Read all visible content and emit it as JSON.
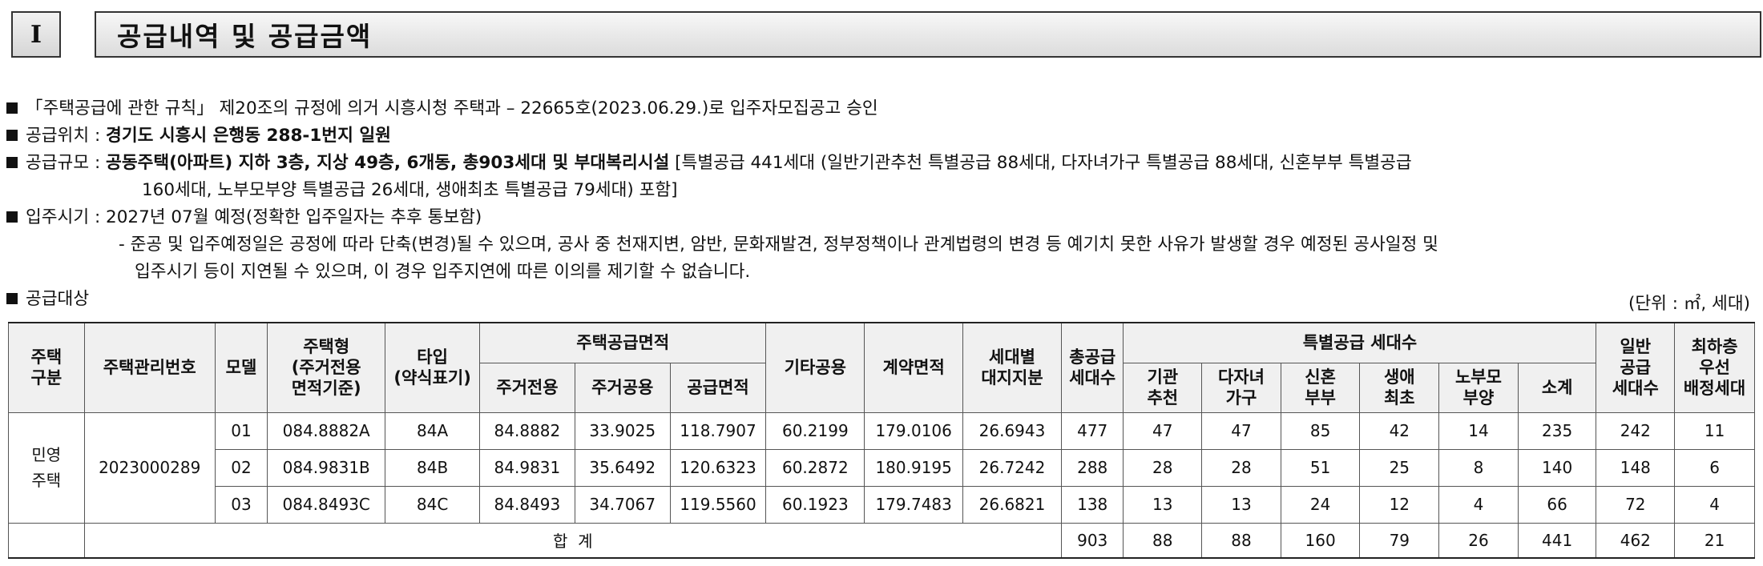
{
  "section": {
    "number": "I",
    "title": "공급내역 및 공급금액"
  },
  "bullets": {
    "l1": "「주택공급에 관한 규칙」 제20조의 규정에 의거 시흥시청 주택과 – 22665호(2023.06.29.)로 입주자모집공고 승인",
    "l2_label": "공급위치 : ",
    "l2_value": "경기도 시흥시 은행동 288-1번지 일원",
    "l3_label": "공급규모 : ",
    "l3_bold": "공동주택(아파트) 지하 3층, 지상 49층, 6개동, 총903세대 및 부대복리시설",
    "l3_rest": " [특별공급 441세대 (일반기관추천 특별공급 88세대, 다자녀가구 특별공급 88세대, 신혼부부 특별공급",
    "l3_cont": "160세대, 노부모부양 특별공급 26세대, 생애최초 특별공급 79세대) 포함]",
    "l4": "입주시기 : 2027년 07월 예정(정확한 입주일자는 추후 통보함)",
    "l4_note1": "- 준공 및 입주예정일은 공정에 따라 단축(변경)될 수 있으며, 공사 중 천재지변, 암반, 문화재발견, 정부정책이나 관계법령의 변경 등 예기치 못한 사유가 발생할 경우 예정된 공사일정 및",
    "l4_note2": "입주시기 등이 지연될 수 있으며, 이 경우 입주지연에 따른 이의를 제기할 수 없습니다.",
    "l5": "공급대상"
  },
  "unit": "(단위 : ㎡, 세대)",
  "table": {
    "h_type": "주택\n구분",
    "h_mgmt": "주택관리번호",
    "h_model": "모델",
    "h_htype": "주택형\n(주거전용\n면적기준)",
    "h_tab": "타입\n(약식표기)",
    "h_area": "주택공급면적",
    "h_area_excl": "주거전용",
    "h_area_common": "주거공용",
    "h_area_supply": "공급면적",
    "h_other": "기타공용",
    "h_contract": "계약면적",
    "h_land": "세대별\n대지지분",
    "h_total": "총공급\n세대수",
    "h_special": "특별공급 세대수",
    "h_sp_inst": "기관\n추천",
    "h_sp_multi": "다자녀\n가구",
    "h_sp_newly": "신혼\n부부",
    "h_sp_first": "생애\n최초",
    "h_sp_elder": "노부모\n부양",
    "h_sp_sum": "소계",
    "h_general": "일반\n공급\n세대수",
    "h_lowest": "최하층\n우선\n배정세대",
    "house_type": "민영\n주택",
    "mgmt_no": "2023000289",
    "rows": [
      {
        "model": "01",
        "htype": "084.8882A",
        "tab": "84A",
        "excl": "84.8882",
        "common": "33.9025",
        "supply": "118.7907",
        "other": "60.2199",
        "contract": "179.0106",
        "land": "26.6943",
        "total": "477",
        "inst": "47",
        "multi": "47",
        "newly": "85",
        "first": "42",
        "elder": "14",
        "sum": "235",
        "general": "242",
        "lowest": "11"
      },
      {
        "model": "02",
        "htype": "084.9831B",
        "tab": "84B",
        "excl": "84.9831",
        "common": "35.6492",
        "supply": "120.6323",
        "other": "60.2872",
        "contract": "180.9195",
        "land": "26.7242",
        "total": "288",
        "inst": "28",
        "multi": "28",
        "newly": "51",
        "first": "25",
        "elder": "8",
        "sum": "140",
        "general": "148",
        "lowest": "6"
      },
      {
        "model": "03",
        "htype": "084.8493C",
        "tab": "84C",
        "excl": "84.8493",
        "common": "34.7067",
        "supply": "119.5560",
        "other": "60.1923",
        "contract": "179.7483",
        "land": "26.6821",
        "total": "138",
        "inst": "13",
        "multi": "13",
        "newly": "24",
        "first": "12",
        "elder": "4",
        "sum": "66",
        "general": "72",
        "lowest": "4"
      }
    ],
    "sum_label": "합  계",
    "sum": {
      "total": "903",
      "inst": "88",
      "multi": "88",
      "newly": "160",
      "first": "79",
      "elder": "26",
      "sum": "441",
      "general": "462",
      "lowest": "21"
    }
  }
}
